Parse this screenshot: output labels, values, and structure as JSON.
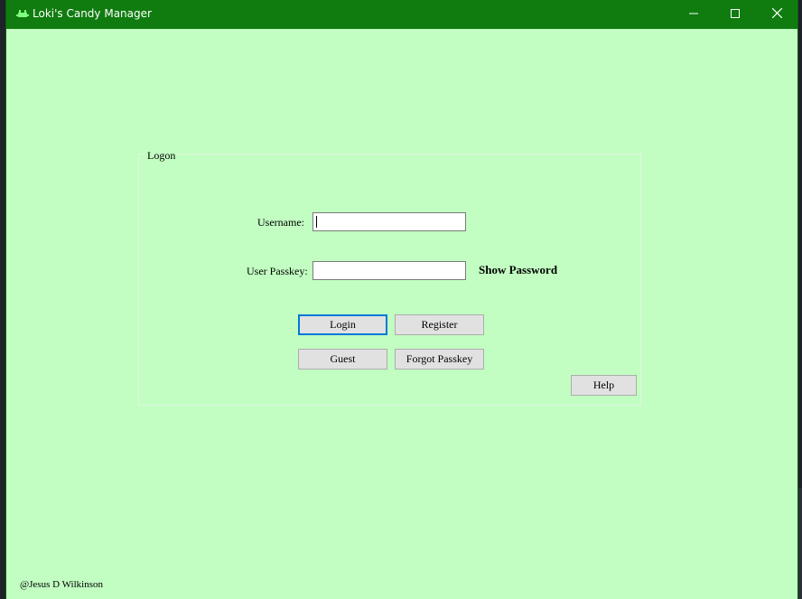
{
  "window": {
    "title": "Loki's Candy Manager",
    "colors": {
      "titlebar": "#107c10",
      "client": "#c2fec2",
      "accent": "#0078d7"
    },
    "controls": {
      "minimize_icon": "minimize-icon",
      "maximize_icon": "maximize-icon",
      "close_icon": "close-icon"
    }
  },
  "logon": {
    "group_title": "Logon",
    "username": {
      "label": "Username:",
      "value": ""
    },
    "passkey": {
      "label": "User Passkey:",
      "value": ""
    },
    "show_password_label": "Show Password",
    "buttons": {
      "login": "Login",
      "register": "Register",
      "guest": "Guest",
      "forgot": "Forgot Passkey",
      "help": "Help"
    }
  },
  "footer": {
    "credit": "@Jesus D Wilkinson"
  }
}
